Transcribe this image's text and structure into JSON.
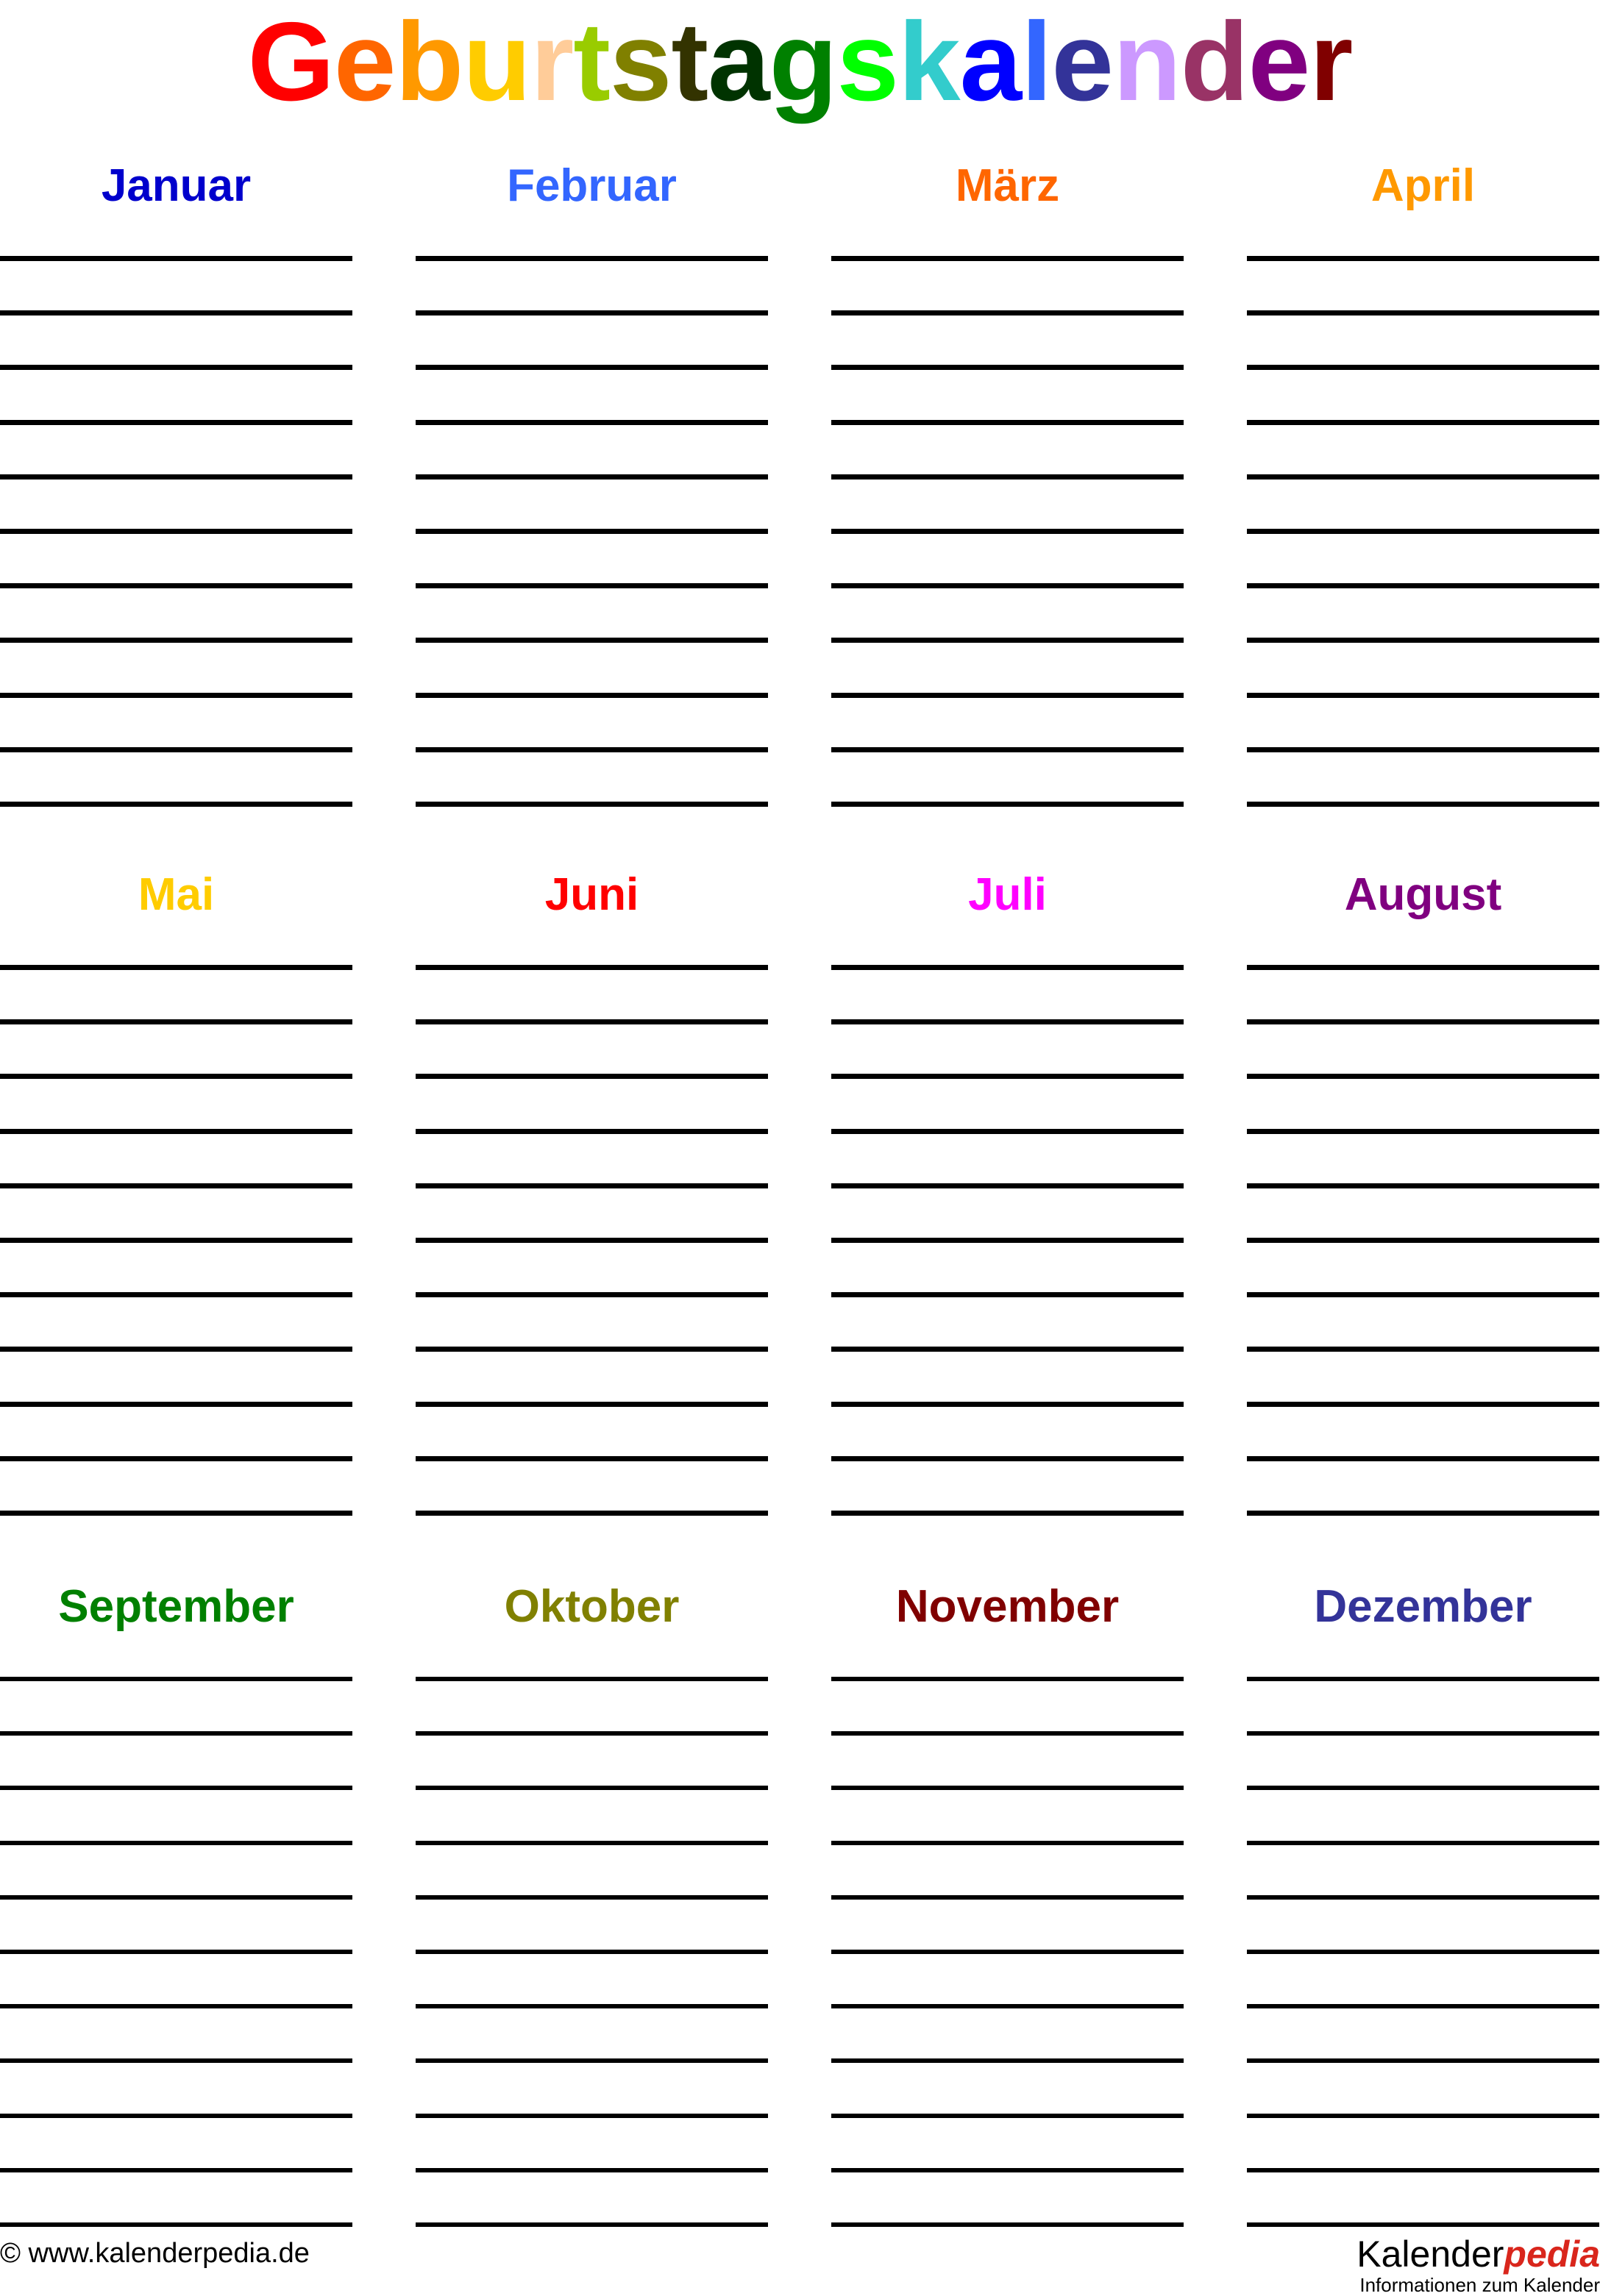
{
  "document": {
    "title": "Geburtstagskalender",
    "title_letters": [
      {
        "char": "G",
        "color": "#FF0000"
      },
      {
        "char": "e",
        "color": "#FF6600"
      },
      {
        "char": "b",
        "color": "#FF9900"
      },
      {
        "char": "u",
        "color": "#FFCC00"
      },
      {
        "char": "r",
        "color": "#FFCC99"
      },
      {
        "char": "t",
        "color": "#99CC00"
      },
      {
        "char": "s",
        "color": "#808000"
      },
      {
        "char": "t",
        "color": "#333300"
      },
      {
        "char": "a",
        "color": "#003300"
      },
      {
        "char": "g",
        "color": "#008000"
      },
      {
        "char": "s",
        "color": "#00FF00"
      },
      {
        "char": "k",
        "color": "#33CCCC"
      },
      {
        "char": "a",
        "color": "#0000FF"
      },
      {
        "char": "l",
        "color": "#3366FF"
      },
      {
        "char": "e",
        "color": "#333399"
      },
      {
        "char": "n",
        "color": "#CC99FF"
      },
      {
        "char": "d",
        "color": "#993366"
      },
      {
        "char": "e",
        "color": "#800080"
      },
      {
        "char": "r",
        "color": "#800000"
      }
    ]
  },
  "blocks": [
    {
      "id": "block-1",
      "months": [
        {
          "label": "Januar",
          "color": "#0000CC",
          "lines": 11
        },
        {
          "label": "Februar",
          "color": "#3366FF",
          "lines": 11
        },
        {
          "label": "März",
          "color": "#FF6600",
          "lines": 11
        },
        {
          "label": "April",
          "color": "#FF9900",
          "lines": 11
        }
      ]
    },
    {
      "id": "block-2",
      "months": [
        {
          "label": "Mai",
          "color": "#FFCC00",
          "lines": 11
        },
        {
          "label": "Juni",
          "color": "#FF0000",
          "lines": 11
        },
        {
          "label": "Juli",
          "color": "#FF00FF",
          "lines": 11
        },
        {
          "label": "August",
          "color": "#800080",
          "lines": 11
        }
      ]
    },
    {
      "id": "block-3",
      "months": [
        {
          "label": "September",
          "color": "#008000",
          "lines": 11
        },
        {
          "label": "Oktober",
          "color": "#808000",
          "lines": 11
        },
        {
          "label": "November",
          "color": "#800000",
          "lines": 11
        },
        {
          "label": "Dezember",
          "color": "#333399",
          "lines": 11
        }
      ]
    }
  ],
  "footer": {
    "copyright": "© www.kalenderpedia.de",
    "logo": {
      "word_primary": "Kalender",
      "word_accent": "pedia",
      "tagline": "Informationen zum Kalender",
      "accent_color": "#d9261c"
    }
  }
}
